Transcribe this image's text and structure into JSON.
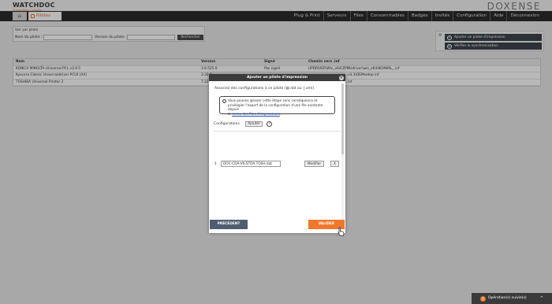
{
  "header": {
    "logo_main": "WATCHDOC",
    "logo_sub": "Supervision Console",
    "brand": "DOXENSE",
    "home_icon": "home-icon",
    "page_tab": "Pilotes",
    "nav": [
      "Plug & Print",
      "Serveurs",
      "Files",
      "Consommables",
      "Badges",
      "Invités",
      "Configuration",
      "Aide",
      "Déconnexion"
    ]
  },
  "search": {
    "title": "Voir par pilote",
    "name_label": "Nom du pilote :",
    "version_label": "Version du pilote :",
    "button": "Rechercher"
  },
  "actions": {
    "add_driver": "Ajouter un pilote d'impression",
    "verify_sync": "Vérifier la synchronisation"
  },
  "table": {
    "headers": [
      "Nom",
      "Version",
      "Signé",
      "Chemin vers .inf"
    ],
    "rows": [
      [
        "KONICA MINOLTA Universal PCL v3.9.5",
        "3.9.525.0",
        "Pas signé",
        "UPDRIVER\\Win_x64\\ZPMUdriver\\win_x64\\KOAWAL_.inf"
      ],
      [
        "Kyocera Classic Universaldriver PCL6 (A4)",
        "3.30.0",
        "",
        "...v3.3\\OEMsetup.inf"
      ],
      [
        "TOSHIBA Universal Printer 2",
        "7.222",
        "",
        "...inf"
      ]
    ]
  },
  "modal": {
    "title": "Ajouter un pilote d'impression",
    "close": "×",
    "assoc_text": "Associez des configurations à ce pilote (",
    "assoc_dat": ".dat ou ",
    "assoc_xml": ".xml).",
    "info_line1": "Vous pouvez ignorer cette étape sans conséquence et",
    "info_line2": "privilégier l'export de la configuration d'une file existante depuis",
    "info_line3_prefix": "le ",
    "info_link": "menu des files d'impressions",
    "info_line3_suffix": ".",
    "configs_label": "Configurations",
    "add_button": "Ajouter",
    "help": "?",
    "config_index": "1",
    "config_file": "DOC-CDA-V6-STDA.TOSH.dat",
    "modify_button": "Modifier",
    "remove_button": "X",
    "prev_button": "PRÉCÉDENT",
    "validate_button": "VALIDER"
  },
  "operations": {
    "label": "Opération(s) suivie(s)",
    "count": "0",
    "chevron": "^"
  }
}
